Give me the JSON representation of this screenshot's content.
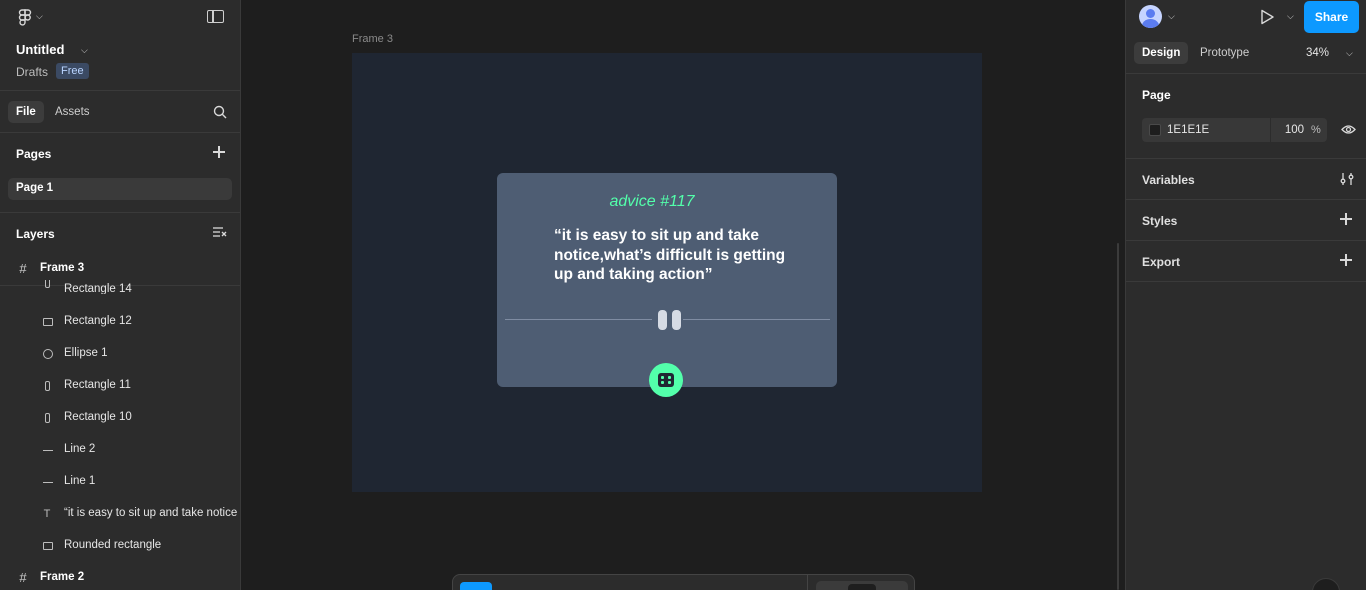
{
  "file": {
    "title": "Untitled",
    "location": "Drafts",
    "plan_badge": "Free"
  },
  "left_tabs": {
    "file": "File",
    "assets": "Assets"
  },
  "pages": {
    "heading": "Pages",
    "items": [
      {
        "label": "Page 1"
      }
    ]
  },
  "layers": {
    "heading": "Layers",
    "items": [
      {
        "label": "Frame 3",
        "type": "frame"
      },
      {
        "label": "Rectangle 14",
        "type": "vrect"
      },
      {
        "label": "Rectangle 12",
        "type": "rect"
      },
      {
        "label": "Ellipse 1",
        "type": "ellipse"
      },
      {
        "label": "Rectangle 11",
        "type": "vrect"
      },
      {
        "label": "Rectangle 10",
        "type": "vrect"
      },
      {
        "label": "Line 2",
        "type": "line"
      },
      {
        "label": "Line 1",
        "type": "line"
      },
      {
        "label": "“it is easy to sit up and take notice",
        "type": "text"
      },
      {
        "label": "Rounded rectangle",
        "type": "rect"
      },
      {
        "label": "Frame 2",
        "type": "frame"
      }
    ]
  },
  "canvas": {
    "frame_label": "Frame 3",
    "card": {
      "title": "advice #117",
      "quote": "“it is easy to sit up and take notice,what’s difficult is getting up and taking action”"
    }
  },
  "right": {
    "share_label": "Share",
    "tabs": {
      "design": "Design",
      "prototype": "Prototype"
    },
    "zoom": "34%",
    "page_section": {
      "heading": "Page",
      "color_hex": "1E1E1E",
      "opacity": "100",
      "opacity_unit": "%"
    },
    "sections": {
      "variables": "Variables",
      "styles": "Styles",
      "export": "Export"
    }
  },
  "colors": {
    "accent": "#0d99ff",
    "card_bg": "#4e5d73",
    "frame_bg": "#1f2632",
    "advice_green": "#53ffab"
  }
}
